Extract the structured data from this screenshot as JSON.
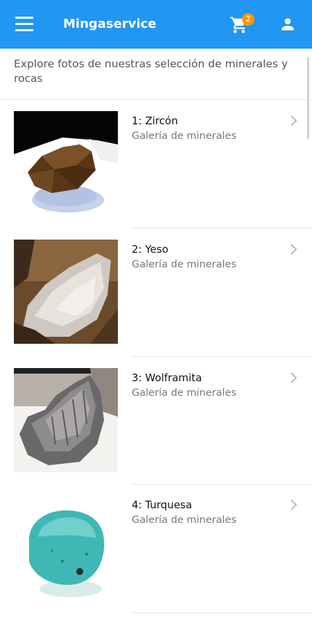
{
  "header": {
    "title": "Mingaservice",
    "cart_count": "2",
    "menu_icon": "hamburger-menu-icon",
    "cart_icon": "shopping-cart-icon",
    "user_icon": "person-icon"
  },
  "intro": "Explore fotos de nuestras selección de minerales y rocas",
  "items": [
    {
      "title": "1: Zircón",
      "subtitle": "Galería de minerales"
    },
    {
      "title": "2: Yeso",
      "subtitle": "Galería de minerales"
    },
    {
      "title": "3: Wolframita",
      "subtitle": "Galería de minerales"
    },
    {
      "title": "4: Turquesa",
      "subtitle": "Galería de minerales"
    }
  ],
  "colors": {
    "appbar": "#2196f3",
    "badge": "#ff9800"
  }
}
